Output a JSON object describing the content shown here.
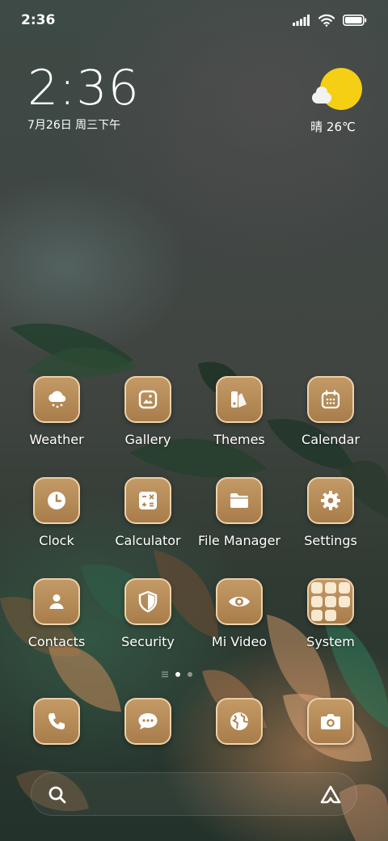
{
  "status_bar": {
    "time": "2:36"
  },
  "clock_widget": {
    "time": "2:36",
    "date": "7月26日 周三下午"
  },
  "weather_widget": {
    "condition": "晴",
    "temperature": "26℃",
    "text": "晴 26℃"
  },
  "apps": [
    {
      "label": "Weather",
      "icon": "cloud-snow-icon"
    },
    {
      "label": "Gallery",
      "icon": "image-icon"
    },
    {
      "label": "Themes",
      "icon": "palette-icon"
    },
    {
      "label": "Calendar",
      "icon": "calendar-icon"
    },
    {
      "label": "Clock",
      "icon": "clock-icon"
    },
    {
      "label": "Calculator",
      "icon": "calculator-icon"
    },
    {
      "label": "File Manager",
      "icon": "folder-icon"
    },
    {
      "label": "Settings",
      "icon": "gear-icon"
    },
    {
      "label": "Contacts",
      "icon": "person-icon"
    },
    {
      "label": "Security",
      "icon": "shield-icon"
    },
    {
      "label": "Mi Video",
      "icon": "eye-icon"
    },
    {
      "label": "System",
      "icon": "folder-grid-icon"
    }
  ],
  "dock": [
    {
      "icon": "phone-icon"
    },
    {
      "icon": "message-icon"
    },
    {
      "icon": "globe-icon"
    },
    {
      "icon": "camera-icon"
    }
  ],
  "page_indicator": {
    "pages": 2,
    "current": 1
  },
  "search_bar": {
    "left_icon": "search-icon",
    "right_icon": "assistant-icon"
  },
  "colors": {
    "icon_gradient_top": "#c39a66",
    "icon_gradient_bottom": "#a87d4b",
    "sun": "#f5cf14"
  }
}
